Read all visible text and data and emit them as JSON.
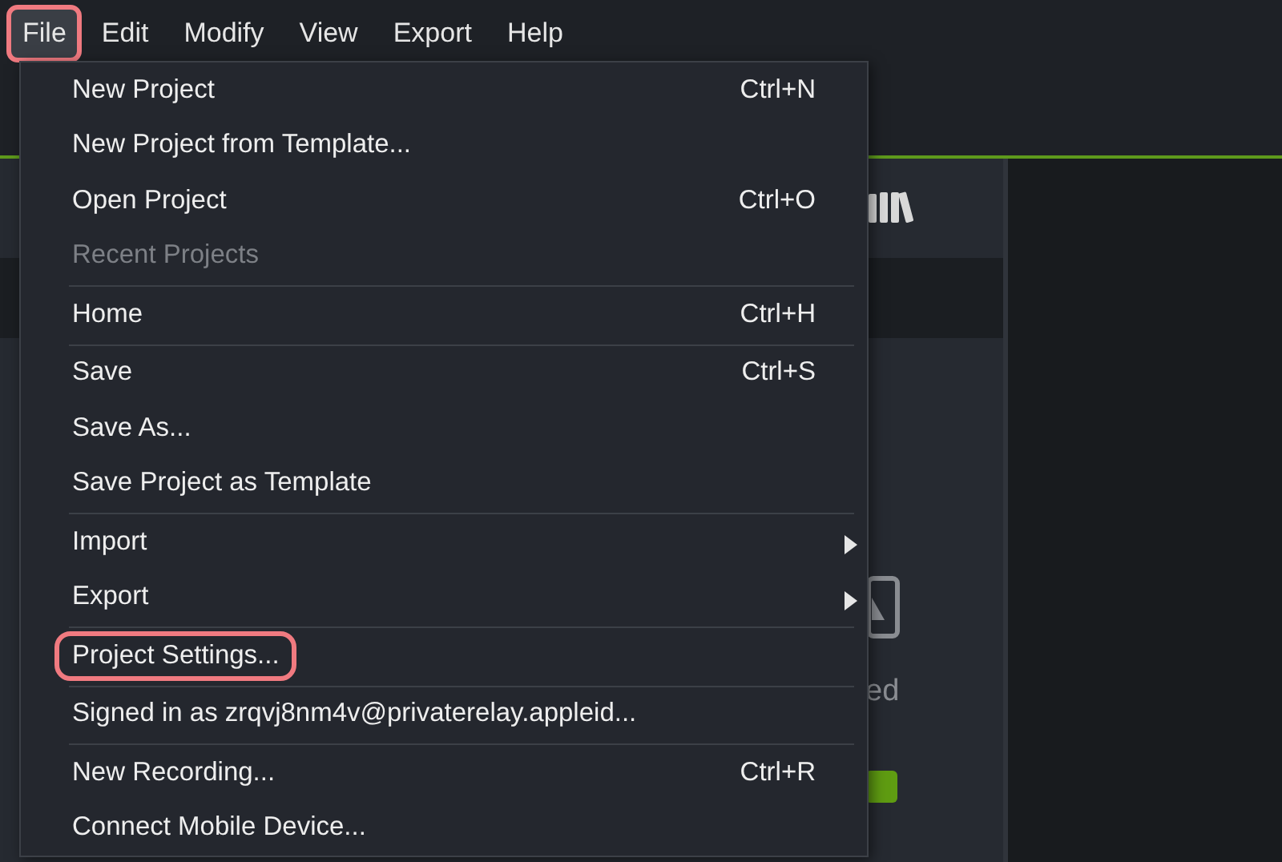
{
  "menubar": [
    {
      "label": "File",
      "selected": true,
      "highlighted": true
    },
    {
      "label": "Edit",
      "selected": false,
      "highlighted": false
    },
    {
      "label": "Modify",
      "selected": false,
      "highlighted": false
    },
    {
      "label": "View",
      "selected": false,
      "highlighted": false
    },
    {
      "label": "Export",
      "selected": false,
      "highlighted": false
    },
    {
      "label": "Help",
      "selected": false,
      "highlighted": false
    }
  ],
  "background": {
    "caption": "ed"
  },
  "file_menu": {
    "groups": [
      [
        {
          "label": "New Project",
          "shortcut": "Ctrl+N",
          "disabled": false,
          "highlighted": false,
          "submenu": false
        },
        {
          "label": "New Project from Template...",
          "disabled": false,
          "highlighted": false,
          "submenu": false
        },
        {
          "label": "Open Project",
          "shortcut": "Ctrl+O",
          "disabled": false,
          "highlighted": false,
          "submenu": false
        },
        {
          "label": "Recent Projects",
          "disabled": true,
          "highlighted": false,
          "submenu": false
        }
      ],
      [
        {
          "label": "Home",
          "shortcut": "Ctrl+H",
          "disabled": false,
          "highlighted": false,
          "submenu": false
        }
      ],
      [
        {
          "label": "Save",
          "shortcut": "Ctrl+S",
          "disabled": false,
          "highlighted": false,
          "submenu": false
        },
        {
          "label": "Save As...",
          "disabled": false,
          "highlighted": false,
          "submenu": false
        },
        {
          "label": "Save Project as Template",
          "disabled": false,
          "highlighted": false,
          "submenu": false
        }
      ],
      [
        {
          "label": "Import",
          "disabled": false,
          "highlighted": false,
          "submenu": true
        },
        {
          "label": "Export",
          "disabled": false,
          "highlighted": false,
          "submenu": true
        }
      ],
      [
        {
          "label": "Project Settings...",
          "disabled": false,
          "highlighted": true,
          "submenu": false
        }
      ],
      [
        {
          "label": "Signed in as zrqvj8nm4v@privaterelay.appleid...",
          "disabled": false,
          "highlighted": false,
          "submenu": false
        }
      ],
      [
        {
          "label": "New Recording...",
          "shortcut": "Ctrl+R",
          "disabled": false,
          "highlighted": false,
          "submenu": false
        },
        {
          "label": "Connect Mobile Device...",
          "disabled": false,
          "highlighted": false,
          "submenu": false
        }
      ]
    ]
  }
}
